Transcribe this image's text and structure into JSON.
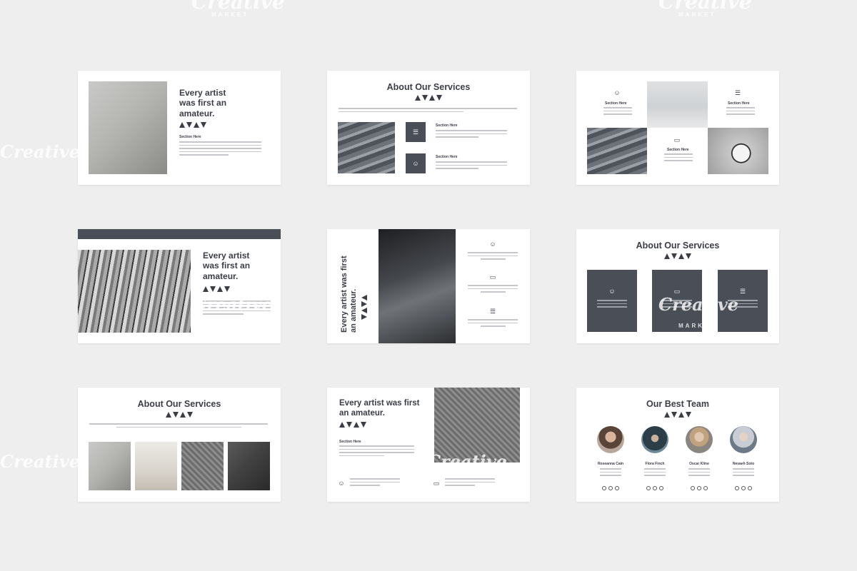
{
  "watermark": {
    "brand": "Creative",
    "sub": "MARKET"
  },
  "slides": {
    "s1": {
      "title": "Every artist was first an amateur.",
      "section": "Section Here"
    },
    "s2": {
      "title": "About Our Services",
      "section_a": "Section Here",
      "section_b": "Section Here"
    },
    "s3": {
      "section_a": "Section Here",
      "section_b": "Section Here",
      "section_c": "Section Here"
    },
    "s4": {
      "title": "Every artist was first an amateur."
    },
    "s5": {
      "title": "Every artist was first an amateur."
    },
    "s6": {
      "title": "About Our Services"
    },
    "s7": {
      "title": "About Our Services"
    },
    "s8": {
      "title": "Every artist was first an amateur.",
      "section": "Section Here"
    },
    "s9": {
      "title": "Our Best Team",
      "members": [
        {
          "name": "Roseanna Cain"
        },
        {
          "name": "Flora Finch"
        },
        {
          "name": "Oscar Kline"
        },
        {
          "name": "Nevaeh Soto"
        }
      ]
    }
  },
  "icons": {
    "person": "person-icon",
    "laptop": "laptop-icon",
    "list": "checklist-icon"
  }
}
